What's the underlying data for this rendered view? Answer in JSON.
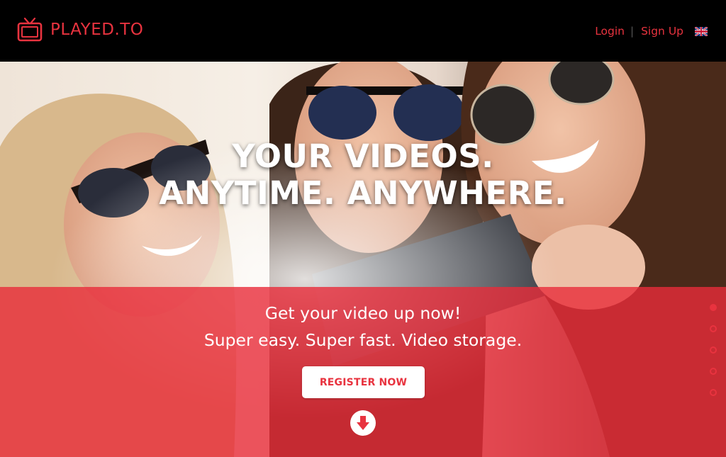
{
  "header": {
    "brand": "PLAYED.TO",
    "nav": {
      "login": "Login",
      "separator": "|",
      "signup": "Sign Up"
    },
    "language_flag": "uk-flag-icon"
  },
  "hero": {
    "headline_line1": "YOUR VIDEOS.",
    "headline_line2": "ANYTIME. ANYWHERE.",
    "tagline_line1": "Get your video up now!",
    "tagline_line2": "Super easy. Super fast. Video storage.",
    "register_label": "REGISTER NOW",
    "scroll_icon": "arrow-down-icon"
  },
  "pagination": {
    "count": 5,
    "active_index": 0
  },
  "colors": {
    "brand_red": "#e8333f",
    "header_bg": "#000000",
    "overlay_red": "#e82c3a"
  }
}
